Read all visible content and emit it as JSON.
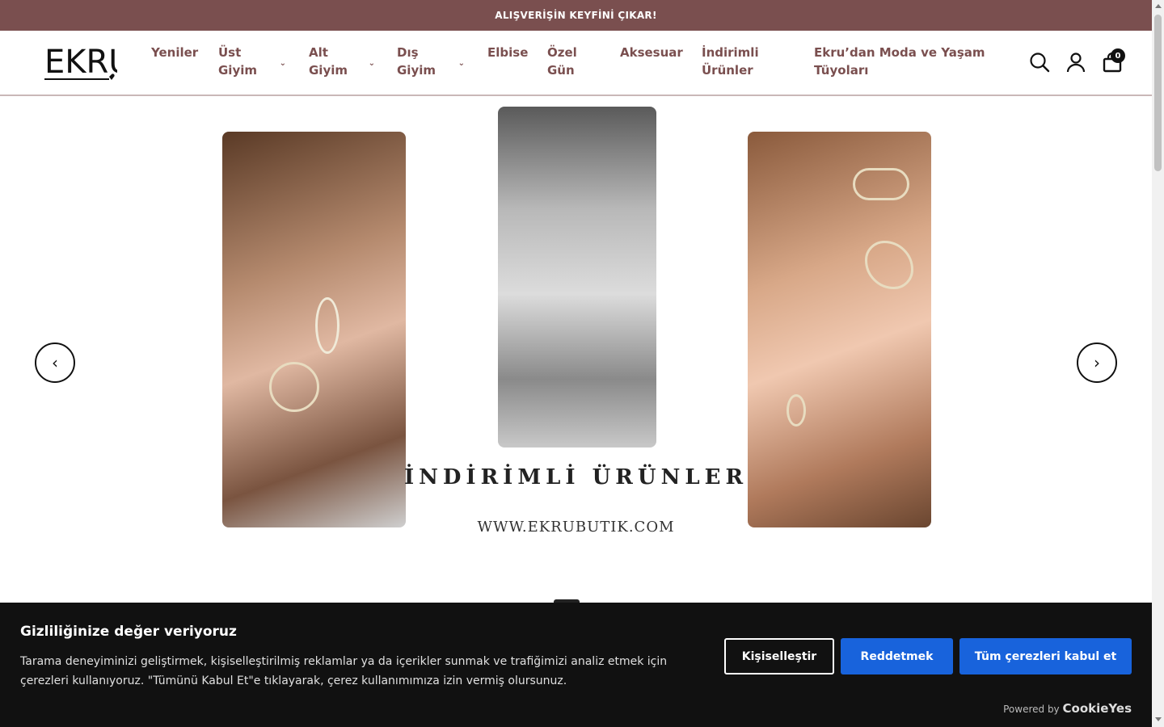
{
  "announcement": "ALIŞVERİŞİN KEYFİNİ ÇIKAR!",
  "logo_text": "EKRU",
  "nav": {
    "yeniler": "Yeniler",
    "ust_giyim": "Üst Giyim",
    "alt_giyim": "Alt Giyim",
    "dis_giyim": "Dış Giyim",
    "elbise": "Elbise",
    "ozel_gun": "Özel Gün",
    "aksesuar": "Aksesuar",
    "indirimli": "İndirimli Ürünler",
    "tuyolar": "Ekru’dan Moda ve Yaşam Tüyoları"
  },
  "header_icons": [
    "search-icon",
    "account-icon",
    "cart-icon"
  ],
  "cart_count": "0",
  "hero": {
    "title": "İNDİRİMLİ ÜRÜNLER",
    "url": "WWW.EKRUBUTIK.COM"
  },
  "cookie": {
    "title": "Gizliliğinize değer veriyoruz",
    "text": "Tarama deneyiminizi geliştirmek, kişiselleştirilmiş reklamlar ya da içerikler sunmak ve trafiğimizi analiz etmek için çerezleri kullanıyoruz. \"Tümünü Kabul Et\"e tıklayarak, çerez kullanımımıza izin vermiş olursunuz.",
    "customize": "Kişiselleştir",
    "reject": "Reddetmek",
    "accept_all": "Tüm çerezleri kabul et",
    "powered_by": "Powered by",
    "powered_brand": "CookieYes"
  },
  "colors": {
    "brand": "#7a4f4f",
    "button_blue": "#1863dc",
    "cookie_bg": "#111111"
  }
}
